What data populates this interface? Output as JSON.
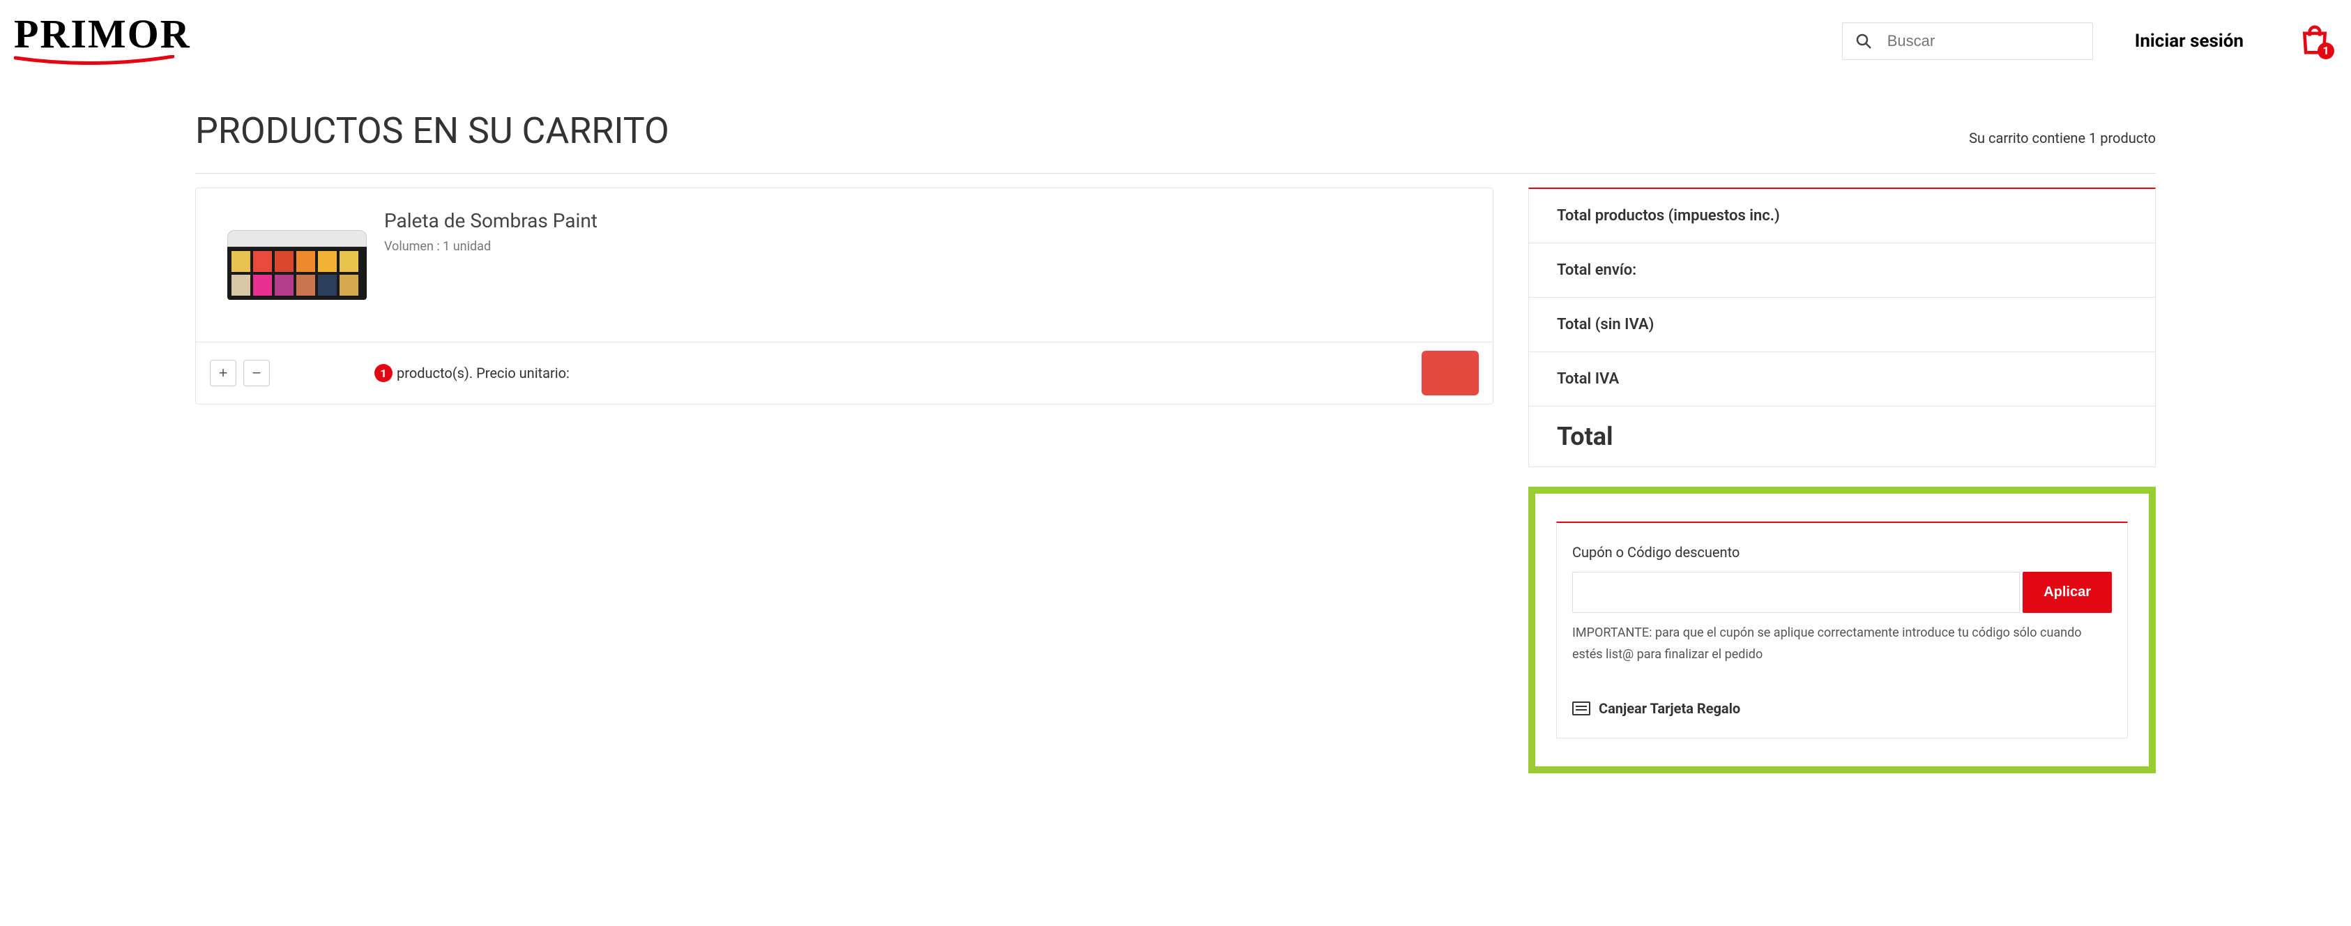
{
  "header": {
    "logo_text": "PRIMOR",
    "search_placeholder": "Buscar",
    "login_label": "Iniciar sesión",
    "cart_qty": "1"
  },
  "page": {
    "title": "PRODUCTOS EN SU CARRITO",
    "cart_count_text": "Su carrito contiene 1 producto"
  },
  "product": {
    "name": "Paleta de Sombras Paint",
    "variant": "Volumen : 1 unidad",
    "qty": "1",
    "qty_suffix": " producto(s). Precio unitario:"
  },
  "summary": {
    "row_products": "Total productos (impuestos inc.)",
    "row_shipping": "Total envío:",
    "row_noiva": "Total (sin IVA)",
    "row_iva": "Total IVA",
    "row_total": "Total"
  },
  "coupon": {
    "label": "Cupón o Código descuento",
    "apply_label": "Aplicar",
    "note": "IMPORTANTE: para que el cupón se aplique correctamente introduce tu código sólo cuando estés list@ para finalizar el pedido"
  },
  "gift": {
    "label": "Canjear Tarjeta Regalo"
  },
  "colors": {
    "brand_red": "#e30613",
    "highlight_green": "#9acd32"
  }
}
